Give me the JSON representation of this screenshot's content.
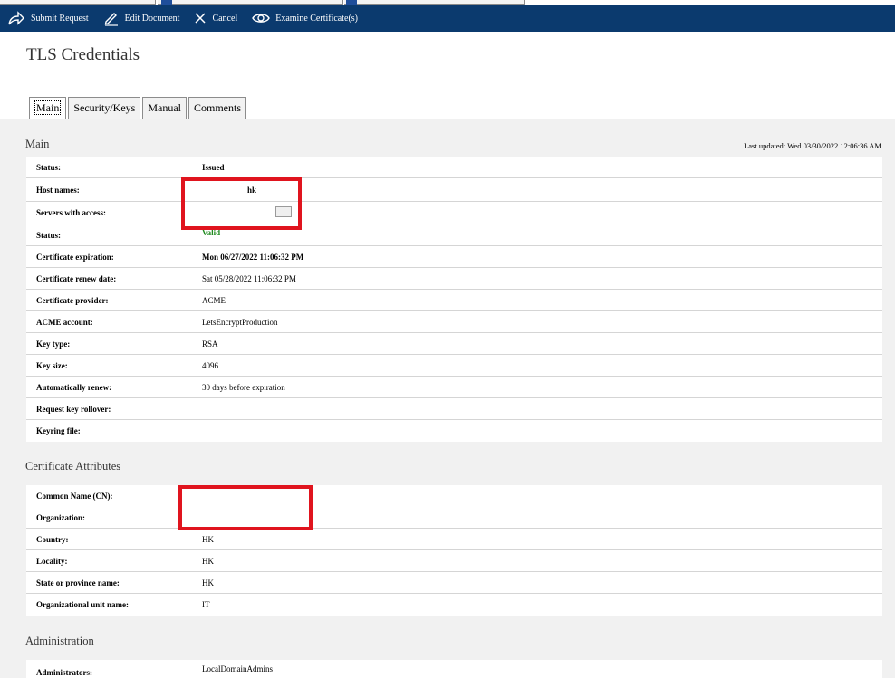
{
  "toolbar": {
    "submit_label": "Submit Request",
    "edit_label": "Edit Document",
    "cancel_label": "Cancel",
    "examine_label": "Examine Certificate(s)"
  },
  "page": {
    "title": "TLS Credentials"
  },
  "tabs": [
    {
      "label": "Main",
      "active": true
    },
    {
      "label": "Security/Keys",
      "active": false
    },
    {
      "label": "Manual",
      "active": false
    },
    {
      "label": "Comments",
      "active": false
    }
  ],
  "main": {
    "heading": "Main",
    "last_updated": "Last updated: Wed 03/30/2022 12:06:36 AM",
    "rows": [
      {
        "label": "Status:",
        "value": "Issued"
      },
      {
        "label": "Host names:",
        "value": "hk"
      },
      {
        "label": "Servers with access:",
        "value": ""
      },
      {
        "label": "Status:",
        "value": "Valid"
      },
      {
        "label": "Certificate expiration:",
        "value": "Mon 06/27/2022 11:06:32 PM"
      },
      {
        "label": "Certificate renew date:",
        "value": "Sat 05/28/2022 11:06:32 PM"
      },
      {
        "label": "Certificate provider:",
        "value": "ACME"
      },
      {
        "label": "ACME account:",
        "value": "LetsEncryptProduction"
      },
      {
        "label": "Key type:",
        "value": "RSA"
      },
      {
        "label": "Key size:",
        "value": "4096"
      },
      {
        "label": "Automatically renew:",
        "value": "30 days before expiration"
      },
      {
        "label": "Request key rollover:",
        "value": ""
      },
      {
        "label": "Keyring file:",
        "value": ""
      }
    ]
  },
  "attributes": {
    "heading": "Certificate Attributes",
    "rows": [
      {
        "label": "Common Name (CN):",
        "value": ""
      },
      {
        "label": "Organization:",
        "value": ""
      },
      {
        "label": "Country:",
        "value": "HK"
      },
      {
        "label": "Locality:",
        "value": "HK"
      },
      {
        "label": "State or province name:",
        "value": "HK"
      },
      {
        "label": "Organizational unit name:",
        "value": "IT"
      }
    ]
  },
  "administration": {
    "heading": "Administration",
    "rows": [
      {
        "label": "Administrators:",
        "value": "LocalDomainAdmins"
      }
    ]
  },
  "colors": {
    "toolbar_bg": "#0b3a6e",
    "content_bg": "#f1f1f1",
    "valid_green": "#1e8a1e",
    "highlight_red": "#e0141e"
  },
  "icons": [
    "submit-arrow-icon",
    "edit-pencil-icon",
    "cancel-x-icon",
    "examine-eye-icon"
  ]
}
